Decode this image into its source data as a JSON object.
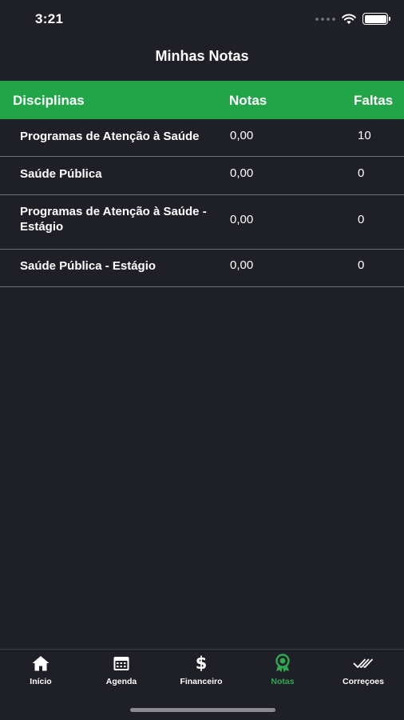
{
  "status_bar": {
    "time": "3:21",
    "icons": [
      "signal-icon",
      "wifi-icon",
      "battery-icon"
    ]
  },
  "header": {
    "title": "Minhas Notas"
  },
  "table": {
    "columns": {
      "disciplinas": "Disciplinas",
      "notas": "Notas",
      "faltas": "Faltas"
    },
    "rows": [
      {
        "disciplina": "Programas de Atenção à Saúde",
        "nota": "0,00",
        "faltas": "10"
      },
      {
        "disciplina": "Saúde Pública",
        "nota": "0,00",
        "faltas": "0"
      },
      {
        "disciplina": "Programas de Atenção à Saúde - Estágio",
        "nota": "0,00",
        "faltas": "0"
      },
      {
        "disciplina": "Saúde Pública - Estágio",
        "nota": "0,00",
        "faltas": "0"
      }
    ]
  },
  "tab_bar": {
    "items": [
      {
        "label": "Início",
        "icon": "home-icon",
        "active": false
      },
      {
        "label": "Agenda",
        "icon": "calendar-icon",
        "active": false
      },
      {
        "label": "Financeiro",
        "icon": "dollar-icon",
        "active": false
      },
      {
        "label": "Notas",
        "icon": "award-icon",
        "active": true
      },
      {
        "label": "Correçoes",
        "icon": "double-check-icon",
        "active": false
      }
    ]
  },
  "colors": {
    "background": "#1f1f28",
    "accent": "#22a449",
    "active_tab": "#2ea84f",
    "divider": "#6f6f76"
  }
}
